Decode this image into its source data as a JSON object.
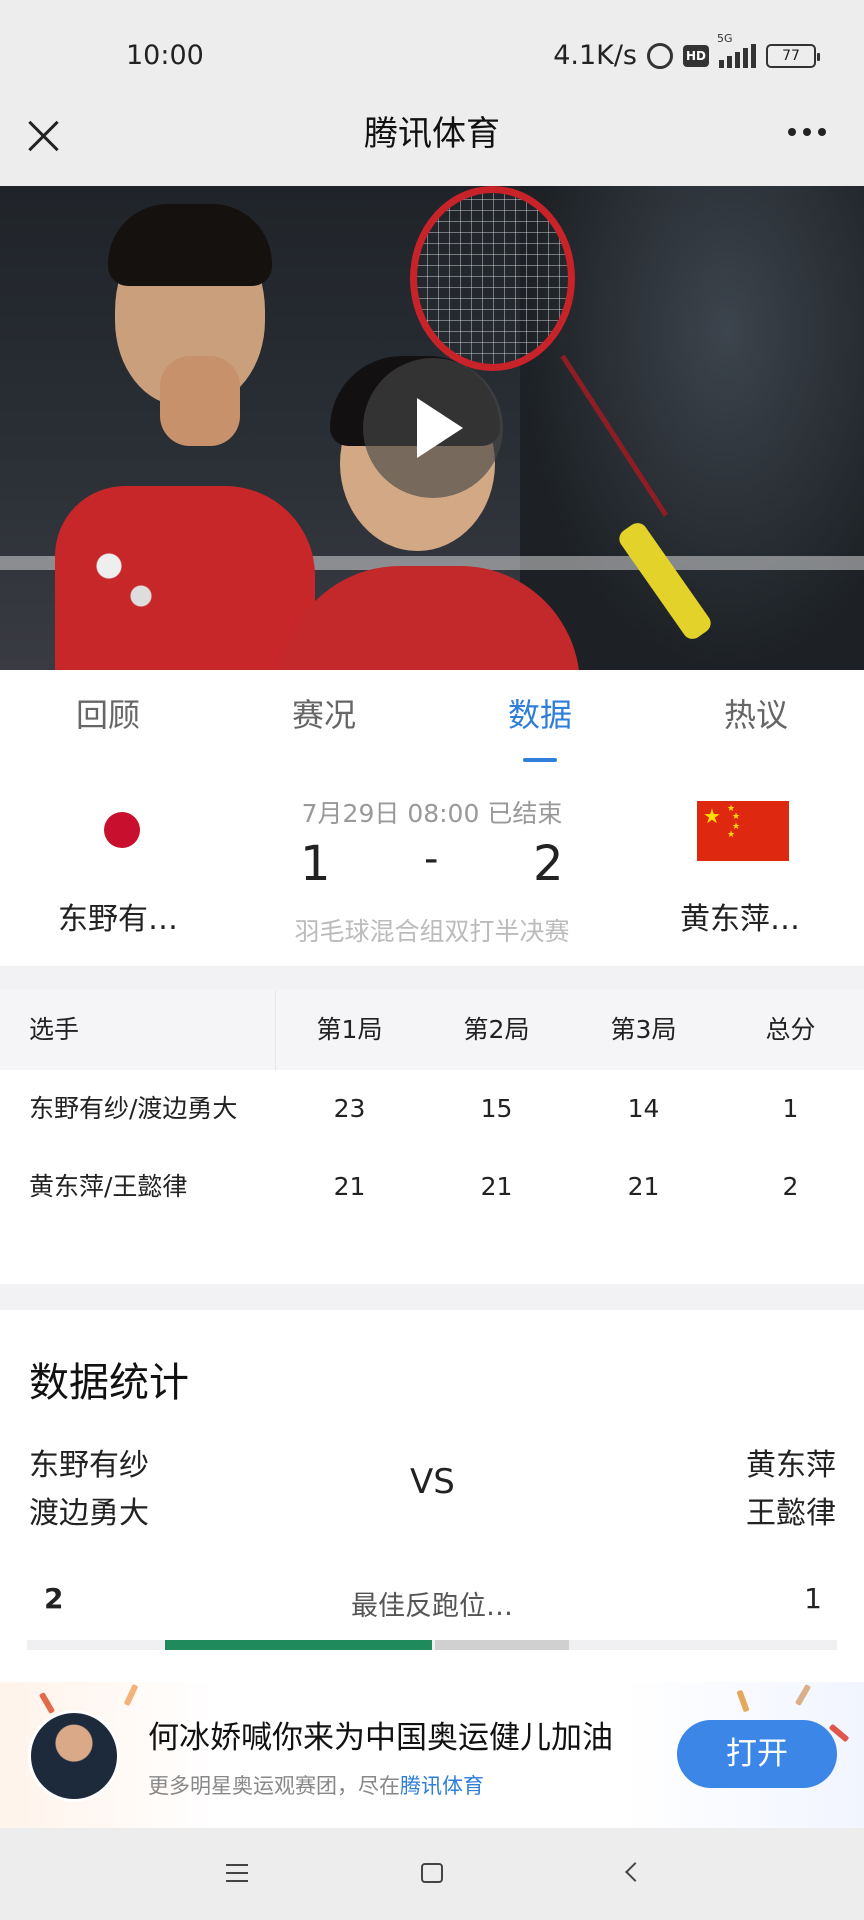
{
  "status_bar": {
    "time": "10:00",
    "speed": "4.1K/s",
    "hd": "HD",
    "net": "5G",
    "battery": "77"
  },
  "header": {
    "title": "腾讯体育"
  },
  "tabs": [
    {
      "label": "回顾"
    },
    {
      "label": "赛况"
    },
    {
      "label": "数据",
      "active": true
    },
    {
      "label": "热议"
    }
  ],
  "match": {
    "team_left": "东野有…",
    "team_right": "黄东萍…",
    "datetime": "7月29日 08:00 已结束",
    "score_left": "1",
    "score_sep": "-",
    "score_right": "2",
    "event": "羽毛球混合组双打半决赛"
  },
  "score_table": {
    "headers": [
      "选手",
      "第1局",
      "第2局",
      "第3局",
      "总分"
    ],
    "rows": [
      [
        "东野有纱/渡边勇大",
        "23",
        "15",
        "14",
        "1"
      ],
      [
        "黄东萍/王懿律",
        "21",
        "21",
        "21",
        "2"
      ]
    ]
  },
  "stats": {
    "title": "数据统计",
    "left_players": [
      "东野有纱",
      "渡边勇大"
    ],
    "right_players": [
      "黄东萍",
      "王懿律"
    ],
    "vs": "VS",
    "items": [
      {
        "label": "最佳反跑位…",
        "left": "2",
        "right": "1"
      }
    ],
    "colors": {
      "left_bar": "#1f8a5c",
      "right_bar": "#d0d0d0"
    }
  },
  "banner": {
    "title": "何冰娇喊你来为中国奥运健儿加油",
    "sub_prefix": "更多明星奥运观赛团，尽在",
    "sub_link": "腾讯体育",
    "button": "打开"
  },
  "colors": {
    "accent": "#2f7ed8",
    "open_button": "#3b86e6"
  }
}
